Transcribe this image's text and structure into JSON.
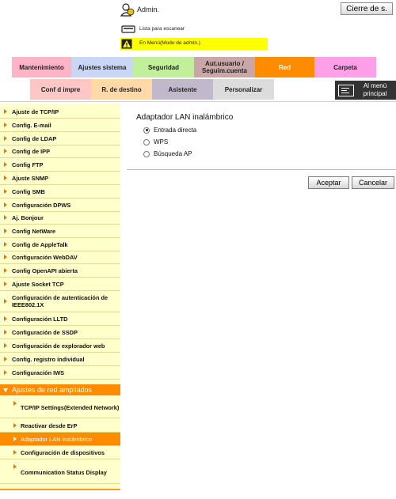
{
  "header": {
    "user_label": "Admin.",
    "logout_label": "Cierre de s.",
    "scan_status": "Lista para escanear",
    "admin_mode": "En Menú(Modo de admin.)"
  },
  "tabs_row1": [
    {
      "label": "Mantenimiento",
      "color": "#ffb3c6"
    },
    {
      "label": "Ajustes sistema",
      "color": "#c9d6f5"
    },
    {
      "label": "Seguridad",
      "color": "#c2f09a"
    },
    {
      "label": "Aut.usuario / Seguim.cuenta",
      "color": "#c9a7a7"
    },
    {
      "label": "Red",
      "color": "#ff8c00"
    },
    {
      "label": "Carpeta",
      "color": "#ff9fe8"
    }
  ],
  "tabs_row2": [
    {
      "label": "Conf d impre",
      "color": "#ffc6c6"
    },
    {
      "label": "R. de destino",
      "color": "#ffd9a8"
    },
    {
      "label": "Asistente",
      "color": "#c2b8cc"
    },
    {
      "label": "Personalizar",
      "color": "#dcdcdc"
    }
  ],
  "home_label": "Al menú principal",
  "sidebar": {
    "items": [
      "Ajuste de TCP/IP",
      "Config. E-mail",
      "Config de LDAP",
      "Config de IPP",
      "Config FTP",
      "Ajuste SNMP",
      "Config SMB",
      "Configuración DPWS",
      "Aj. Bonjour",
      "Config NetWare",
      "Config de AppleTalk",
      "Configuración WebDAV",
      "Config OpenAPI abierta",
      "Ajuste Socket TCP",
      "Configuración de autenticación de IEEE802.1X",
      "Configuración LLTD",
      "Configuración de SSDP",
      "Configuración de explorador web",
      "Config. registro individual",
      "Configuración IWS"
    ],
    "section_label": "Ajustes de red ampliados",
    "sub_items": [
      "TCP/IP Settings(Extended Network)",
      "Reactivar desde ErP",
      "Adaptador LAN inalámbrico",
      "Configuración de dispositivos",
      "Communication Status Display"
    ]
  },
  "main": {
    "title": "Adaptador LAN inalámbrico",
    "options": [
      {
        "label": "Entrada directa",
        "selected": true
      },
      {
        "label": "WPS",
        "selected": false
      },
      {
        "label": "Búsqueda AP",
        "selected": false
      }
    ],
    "ok_label": "Aceptar",
    "cancel_label": "Cancelar"
  }
}
